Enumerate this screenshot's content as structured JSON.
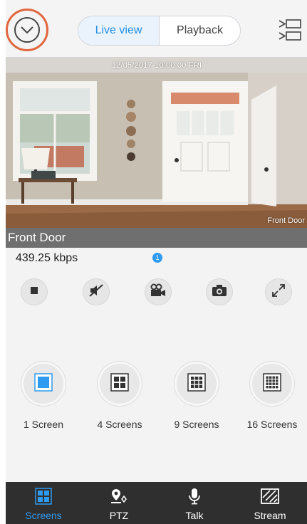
{
  "header": {
    "collapse_label": "",
    "tabs": [
      {
        "label": "Live view",
        "active": true
      },
      {
        "label": "Playback",
        "active": false
      }
    ]
  },
  "video": {
    "timestamp": "12/05/2017 10:00:00 FRI",
    "overlay_name": "Front Door"
  },
  "camera": {
    "name": "Front Door",
    "bitrate": "439.25 kbps",
    "badge_count": "1"
  },
  "controls": [
    "stop-icon",
    "mute-icon",
    "record-video-icon",
    "snapshot-icon",
    "fullscreen-icon"
  ],
  "screens": [
    {
      "label": "1 Screen",
      "grid": 1,
      "active": true
    },
    {
      "label": "4 Screens",
      "grid": 2,
      "active": false
    },
    {
      "label": "9 Screens",
      "grid": 3,
      "active": false
    },
    {
      "label": "16 Screens",
      "grid": 4,
      "active": false
    }
  ],
  "nav": [
    {
      "label": "Screens",
      "icon": "screens-icon",
      "active": true
    },
    {
      "label": "PTZ",
      "icon": "ptz-icon",
      "active": false
    },
    {
      "label": "Talk",
      "icon": "microphone-icon",
      "active": false
    },
    {
      "label": "Stream",
      "icon": "stream-icon",
      "active": false
    }
  ],
  "colors": {
    "accent": "#1f8fe5",
    "highlight_ring": "#e0673f",
    "nav_bg": "#2f2f2f",
    "name_bar": "#6f6f6f"
  }
}
